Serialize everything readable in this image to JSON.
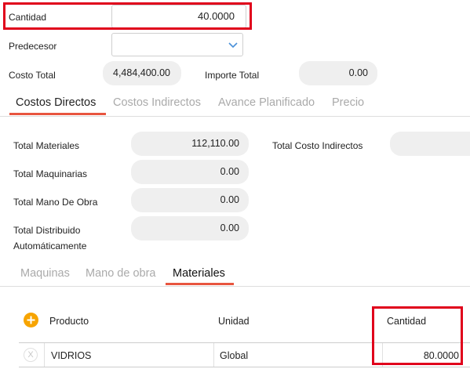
{
  "header": {
    "cantidad_label": "Cantidad",
    "cantidad_value": "40.0000",
    "predecesor_label": "Predecesor",
    "predecesor_value": "",
    "costo_total_label": "Costo Total",
    "costo_total_value": "4,484,400.00",
    "importe_total_label": "Importe Total",
    "importe_total_value": "0.00"
  },
  "tabs": [
    {
      "label": "Costos Directos",
      "active": true
    },
    {
      "label": "Costos Indirectos",
      "active": false
    },
    {
      "label": "Avance Planificado",
      "active": false
    },
    {
      "label": "Precio",
      "active": false
    }
  ],
  "direct_costs": {
    "total_materiales_label": "Total Materiales",
    "total_materiales_value": "112,110.00",
    "total_maquinarias_label": "Total Maquinarias",
    "total_maquinarias_value": "0.00",
    "total_mano_obra_label": "Total Mano De Obra",
    "total_mano_obra_value": "0.00",
    "total_distribuido_label_1": "Total Distribuido",
    "total_distribuido_label_2": "Automáticamente",
    "total_distribuido_value": "0.00",
    "total_costo_indirectos_label": "Total Costo Indirectos",
    "total_costo_indirectos_value": ""
  },
  "subtabs": [
    {
      "label": "Maquinas",
      "active": false
    },
    {
      "label": "Mano de obra",
      "active": false
    },
    {
      "label": "Materiales",
      "active": true
    }
  ],
  "table": {
    "add_icon": "plus-circle-icon",
    "columns": [
      "Producto",
      "Unidad",
      "Cantidad"
    ],
    "rows": [
      {
        "remove_glyph": "X",
        "producto": "VIDRIOS",
        "unidad": "Global",
        "cantidad": "80.0000"
      }
    ]
  },
  "colors": {
    "accent": "#e8553f",
    "highlight": "#e0001b",
    "add_button": "#f7a400"
  }
}
